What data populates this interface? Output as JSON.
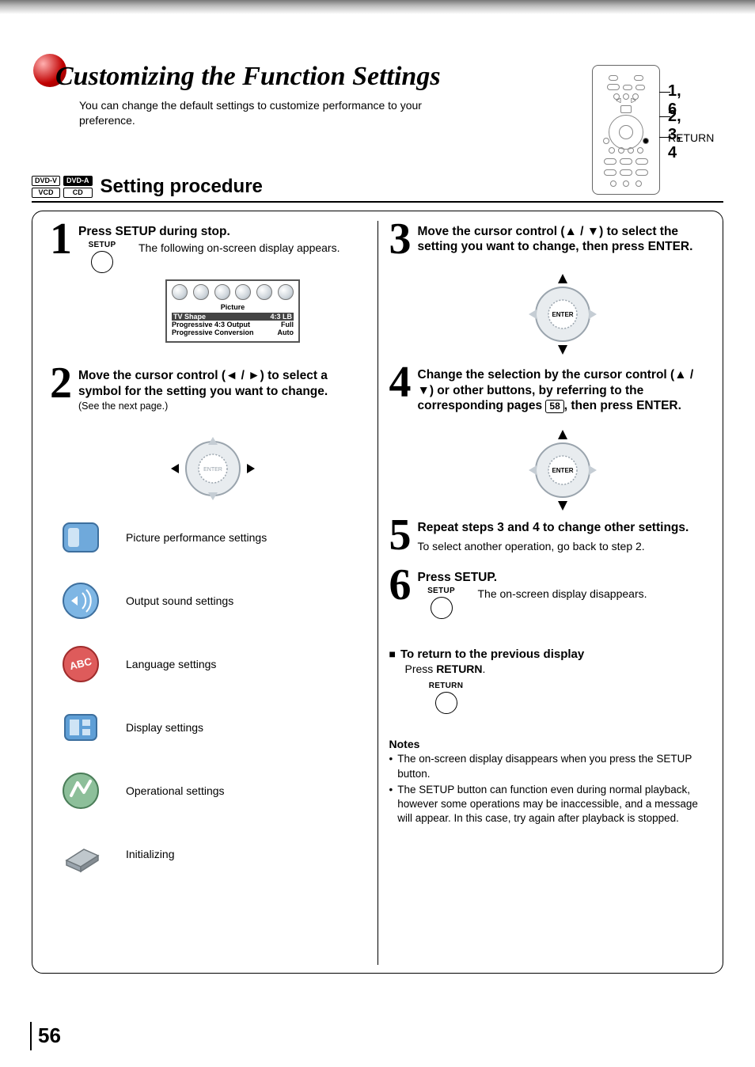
{
  "page_number": "56",
  "header": {
    "title": "Customizing the Function Settings",
    "subtitle": "You can change the default settings to customize performance to your preference."
  },
  "remote_callouts": {
    "c1": "1, 6",
    "c2": "2, 3, 4",
    "c3": "RETURN"
  },
  "section": {
    "badges": {
      "a": "DVD-V",
      "b": "DVD-A",
      "c": "VCD",
      "d": "CD"
    },
    "title": "Setting procedure"
  },
  "steps": {
    "s1": {
      "num": "1",
      "title": "Press SETUP during stop.",
      "setup_label": "SETUP",
      "body": "The following on-screen display appears.",
      "osd": {
        "heading": "Picture",
        "r1l": "TV Shape",
        "r1r": "4:3 LB",
        "r2l": "Progressive 4:3 Output",
        "r2r": "Full",
        "r3l": "Progressive Conversion",
        "r3r": "Auto"
      }
    },
    "s2": {
      "num": "2",
      "title_a": "Move the cursor control (",
      "title_b": ") to select a symbol for the setting you want to change.",
      "see_next": "(See the next page.)",
      "items": {
        "picture": "Picture performance settings",
        "sound": "Output sound settings",
        "lang": "Language settings",
        "disp": "Display settings",
        "oper": "Operational settings",
        "init": "Initializing"
      }
    },
    "s3": {
      "num": "3",
      "title_a": "Move the cursor control (",
      "title_b": ") to select the setting you want to change, then press ENTER."
    },
    "s4": {
      "num": "4",
      "title_a": "Change the selection by the cursor control (",
      "title_b": ") or other buttons, by referring to the corresponding pages ",
      "title_c": ", then press ENTER.",
      "page_ref": "58"
    },
    "s5": {
      "num": "5",
      "title": "Repeat steps 3 and 4 to change other settings.",
      "body": "To select another operation, go back to step 2."
    },
    "s6": {
      "num": "6",
      "title": "Press SETUP.",
      "setup_label": "SETUP",
      "body": "The on-screen display disappears."
    }
  },
  "return_block": {
    "heading": "To return to the previous display",
    "line_a": "Press ",
    "line_b": "RETURN",
    "line_c": ".",
    "button_label": "RETURN"
  },
  "notes": {
    "heading": "Notes",
    "n1": "The on-screen display disappears when you press the SETUP button.",
    "n2": "The SETUP button can function even during normal playback, however some operations may be inaccessible, and a message will appear. In this case, try again after playback is stopped."
  },
  "glyphs": {
    "left": "◄",
    "right": "►",
    "up": "▲",
    "down": "▼",
    "slash": " / ",
    "square": "■",
    "bullet": "•",
    "enter": "ENTER"
  }
}
